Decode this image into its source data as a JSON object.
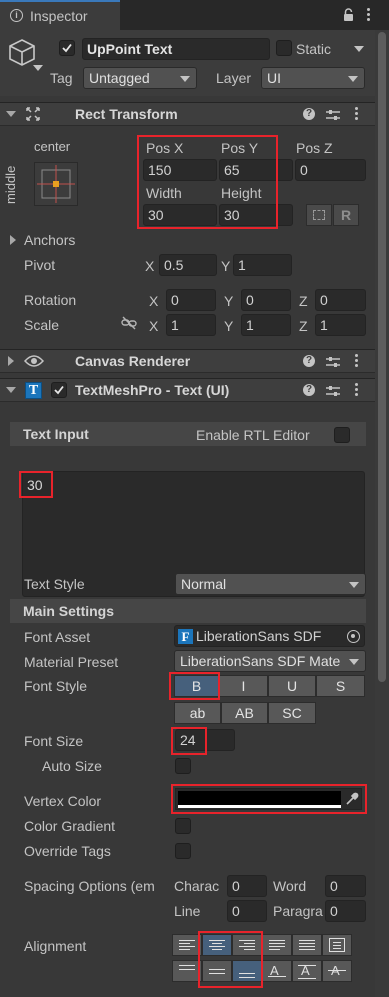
{
  "window": {
    "tab_title": "Inspector",
    "tab_icon": "info-icon",
    "lock_icon": "lock-icon"
  },
  "object": {
    "name": "UpPoint Text",
    "enabled": true,
    "static_label": "Static",
    "tag_label": "Tag",
    "tag_value": "Untagged",
    "layer_label": "Layer",
    "layer_value": "UI"
  },
  "rect_transform": {
    "title": "Rect Transform",
    "anchor_preset_h": "center",
    "anchor_preset_v": "middle",
    "pos_x_label": "Pos X",
    "pos_y_label": "Pos Y",
    "pos_z_label": "Pos Z",
    "pos_x": "150",
    "pos_y": "65",
    "pos_z": "0",
    "width_label": "Width",
    "height_label": "Height",
    "width": "30",
    "height": "30",
    "raw_edit_label": "R",
    "anchors_label": "Anchors",
    "pivot_label": "Pivot",
    "pivot_x_label": "X",
    "pivot_y_label": "Y",
    "pivot_x": "0.5",
    "pivot_y": "1",
    "rotation_label": "Rotation",
    "rot_x": "0",
    "rot_y": "0",
    "rot_z": "0",
    "scale_label": "Scale",
    "scale_x": "1",
    "scale_y": "1",
    "scale_z": "1",
    "x_label": "X",
    "y_label": "Y",
    "z_label": "Z"
  },
  "canvas_renderer": {
    "title": "Canvas Renderer"
  },
  "tmp": {
    "title": "TextMeshPro - Text (UI)",
    "enabled": true,
    "text_input_label": "Text Input",
    "rtl_label": "Enable RTL Editor",
    "text_value": "30",
    "text_style_label": "Text Style",
    "text_style_value": "Normal",
    "main_settings_label": "Main Settings",
    "font_asset_label": "Font Asset",
    "font_asset_value": "LiberationSans SDF",
    "material_preset_label": "Material Preset",
    "material_preset_value": "LiberationSans SDF Mate",
    "font_style_label": "Font Style",
    "style_buttons": [
      "B",
      "I",
      "U",
      "S"
    ],
    "case_buttons": [
      "ab",
      "AB",
      "SC"
    ],
    "font_size_label": "Font Size",
    "font_size_value": "24",
    "auto_size_label": "Auto Size",
    "vertex_color_label": "Vertex Color",
    "vertex_color": "#000000",
    "color_gradient_label": "Color Gradient",
    "override_tags_label": "Override Tags",
    "spacing_label": "Spacing Options (em",
    "charac_label": "Charac",
    "charac_value": "0",
    "word_label": "Word",
    "word_value": "0",
    "line_label": "Line",
    "line_value": "0",
    "paragra_label": "Paragra",
    "paragra_value": "0",
    "alignment_label": "Alignment"
  },
  "colors": {
    "highlight_red": "#e8232b",
    "selected_blue": "#46607c",
    "panel_bg": "#383838"
  }
}
